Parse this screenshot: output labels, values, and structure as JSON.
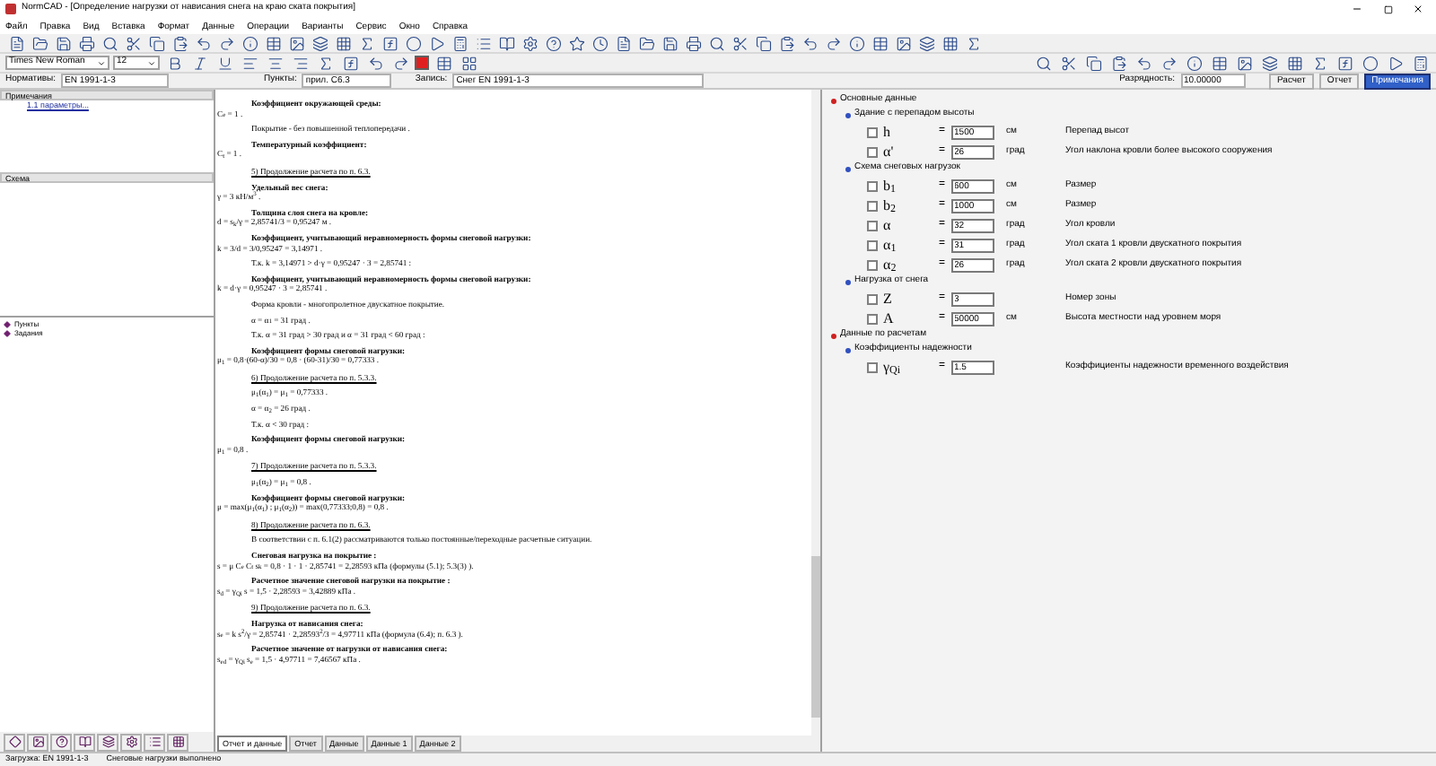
{
  "window": {
    "title": "NormCAD - [Определение нагрузки от нависания снега на краю ската покрытия]"
  },
  "menu": [
    "Файл",
    "Правка",
    "Вид",
    "Вставка",
    "Формат",
    "Данные",
    "Операции",
    "Варианты",
    "Сервис",
    "Окно",
    "Справка"
  ],
  "format_bar": {
    "font": "Times New Roman",
    "size": "12"
  },
  "info_bar": {
    "norms_label": "Нормативы:",
    "norms": "EN 1991-1-3",
    "points_label": "Пункты:",
    "points": "прил. C6.3",
    "record_label": "Запись:",
    "record": "Снег EN 1991-1-3",
    "digits_label": "Разрядность:",
    "digits": "10.00000",
    "calc_button": "Расчет",
    "toggles": [
      {
        "label": "Отчет",
        "selected": false
      },
      {
        "label": "Примечания",
        "selected": true
      }
    ]
  },
  "notes_panel": {
    "title": "Примечания",
    "items": [
      "1.1 параметры..."
    ]
  },
  "scheme_panel": {
    "title": "Схема"
  },
  "tree": [
    {
      "label": "Пункты"
    },
    {
      "label": "Задания"
    }
  ],
  "document": [
    {
      "kind": "heading",
      "text": "Коэффициент окружающей среды:"
    },
    {
      "kind": "formula",
      "text": "C$_{e}$ = 1 ."
    },
    {
      "kind": "text",
      "text": "Покрытие - без повышенной теплопередачи ."
    },
    {
      "kind": "heading",
      "text": "Температурный коэффициент:"
    },
    {
      "kind": "formula",
      "text": "C$_{t}$ = 1 ."
    },
    {
      "kind": "section",
      "text": "5) Продолжение расчета по п. 6.3."
    },
    {
      "kind": "heading",
      "text": "Удельный вес снега:"
    },
    {
      "kind": "formula",
      "text": "γ = 3 кН/м$^{3}$ ."
    },
    {
      "kind": "heading",
      "text": "Толщина слоя снега на кровле:"
    },
    {
      "kind": "formula",
      "text": "d = s$_{k}$/γ = 2,85741/3 = 0,95247 м ."
    },
    {
      "kind": "heading",
      "text": "Коэффициент, учитывающий неравномерность формы снеговой нагрузки:"
    },
    {
      "kind": "formula",
      "text": "k = 3/d = 3/0,95247 = 3,14971 ."
    },
    {
      "kind": "text",
      "text": "Т.к. k = 3,14971 > d·γ = 0,95247 · 3 = 2,85741 :"
    },
    {
      "kind": "heading",
      "text": "Коэффициент, учитывающий неравномерность формы снеговой нагрузки:"
    },
    {
      "kind": "formula",
      "text": "k = d·γ = 0,95247 · 3 = 2,85741 ."
    },
    {
      "kind": "text",
      "text": "Форма кровли - многопролетное двускатное покрытие."
    },
    {
      "kind": "text",
      "text": "α = α$_{1}$ = 31 град ."
    },
    {
      "kind": "text",
      "text": "Т.к. α = 31 град > 30 град и α = 31 град < 60 град :"
    },
    {
      "kind": "heading",
      "text": "Коэффициент формы снеговой нагрузки:"
    },
    {
      "kind": "formula",
      "text": "μ$_{1}$ = 0,8·(60-α)/30 = 0,8 · (60-31)/30 = 0,77333 ."
    },
    {
      "kind": "section",
      "text": "6) Продолжение расчета по п. 5.3.3."
    },
    {
      "kind": "text",
      "text": "μ$_{1}$(α$_{1}$) = μ$_{1}$ = 0,77333 ."
    },
    {
      "kind": "text",
      "text": "α = α$_{2}$ = 26 град ."
    },
    {
      "kind": "text",
      "text": "Т.к. α < 30 град :"
    },
    {
      "kind": "heading",
      "text": "Коэффициент формы снеговой нагрузки:"
    },
    {
      "kind": "formula",
      "text": "μ$_{1}$ = 0,8 ."
    },
    {
      "kind": "section",
      "text": "7) Продолжение расчета по п. 5.3.3."
    },
    {
      "kind": "text",
      "text": "μ$_{1}$(α$_{2}$) = μ$_{1}$ = 0,8 ."
    },
    {
      "kind": "heading",
      "text": "Коэффициент формы снеговой нагрузки:"
    },
    {
      "kind": "formula",
      "text": "μ = max(μ$_{1}$(α$_{1}$) ; μ$_{1}$(α$_{2}$)) = max(0,77333;0,8) = 0,8 ."
    },
    {
      "kind": "section",
      "text": "8) Продолжение расчета по п. 6.3."
    },
    {
      "kind": "text",
      "text": "В соответствии с п. 6.1(2) рассматриваются только постоянные/переходные расчетные ситуации."
    },
    {
      "kind": "heading",
      "text": "Снеговая нагрузка на покрытие :"
    },
    {
      "kind": "formula",
      "text": "s = μ C$_{e}$ C$_{t}$ s$_{k}$ = 0,8 · 1 · 1 · 2,85741 = 2,28593 кПа (формулы (5.1); 5.3(3) )."
    },
    {
      "kind": "heading",
      "text": "Расчетное значение снеговой нагрузки на покрытие :"
    },
    {
      "kind": "formula",
      "text": "s$_{d}$ = γ$_{Qi}$ s = 1,5 · 2,28593 = 3,42889 кПа ."
    },
    {
      "kind": "section",
      "text": "9) Продолжение расчета по п. 6.3."
    },
    {
      "kind": "heading",
      "text": "Нагрузка от нависания снега:"
    },
    {
      "kind": "formula",
      "text": "s$_{e}$ = k s$^{2}$/γ = 2,85741 · 2,28593$^{2}$/3 = 4,97711 кПа (формула (6.4); п. 6.3 )."
    },
    {
      "kind": "heading",
      "text": "Расчетное значение от нагрузки от нависания снега:"
    },
    {
      "kind": "formula",
      "text": "s$_{ed}$ = γ$_{Qi}$ s$_{e}$ = 1,5 · 4,97711 = 7,46567 кПа ."
    }
  ],
  "doc_tabs": [
    {
      "label": "Отчет и данные",
      "selected": true
    },
    {
      "label": "Отчет",
      "selected": false
    },
    {
      "label": "Данные",
      "selected": false
    },
    {
      "label": "Данные 1",
      "selected": false
    },
    {
      "label": "Данные 2",
      "selected": false
    }
  ],
  "data_tree": [
    {
      "label": "Основные данные",
      "expanded": true,
      "children": [
        {
          "label": "Здание с перепадом высоты",
          "expanded": true,
          "children": [
            {
              "symbol": "h",
              "sign": "=",
              "value": "1500",
              "unit": "см",
              "description": "Перепад высот",
              "checked": false
            },
            {
              "symbol": "α'",
              "sign": "=",
              "value": "26",
              "unit": "град",
              "description": "Угол наклона кровли более высокого сооружения",
              "checked": false
            }
          ]
        },
        {
          "label": "Схема снеговых нагрузок",
          "expanded": true,
          "children": [
            {
              "symbol": "b$_{1}$",
              "sign": "=",
              "value": "600",
              "unit": "см",
              "description": "Размер",
              "checked": false
            },
            {
              "symbol": "b$_{2}$",
              "sign": "=",
              "value": "1000",
              "unit": "см",
              "description": "Размер",
              "checked": false
            },
            {
              "symbol": "α",
              "sign": "=",
              "value": "32",
              "unit": "град",
              "description": "Угол кровли",
              "checked": false
            },
            {
              "symbol": "α$_{1}$",
              "sign": "=",
              "value": "31",
              "unit": "град",
              "description": "Угол ската 1 кровли двускатного покрытия",
              "checked": false
            },
            {
              "symbol": "α$_{2}$",
              "sign": "=",
              "value": "26",
              "unit": "град",
              "description": "Угол ската 2 кровли двускатного покрытия",
              "checked": false
            }
          ]
        },
        {
          "label": "Нагрузка от снега",
          "expanded": true,
          "children": [
            {
              "symbol": "Z",
              "sign": "=",
              "value": "3",
              "description": "Номер зоны",
              "checked": false
            },
            {
              "symbol": "A",
              "sign": "=",
              "value": "50000",
              "unit": "см",
              "description": "Высота местности над уровнем моря",
              "checked": false
            }
          ]
        }
      ]
    },
    {
      "label": "Данные по расчетам",
      "expanded": true,
      "children": [
        {
          "label": "Коэффициенты надежности",
          "expanded": true,
          "children": [
            {
              "symbol": "γ$_{Qi}$",
              "sign": "=",
              "value": "1.5",
              "description": "Коэффициенты надежности временного воздействия",
              "checked": false
            }
          ]
        }
      ]
    }
  ],
  "status_bar": {
    "left": "Загрузка: EN 1991-1-3",
    "right": "Снеговые нагрузки выполнено"
  }
}
